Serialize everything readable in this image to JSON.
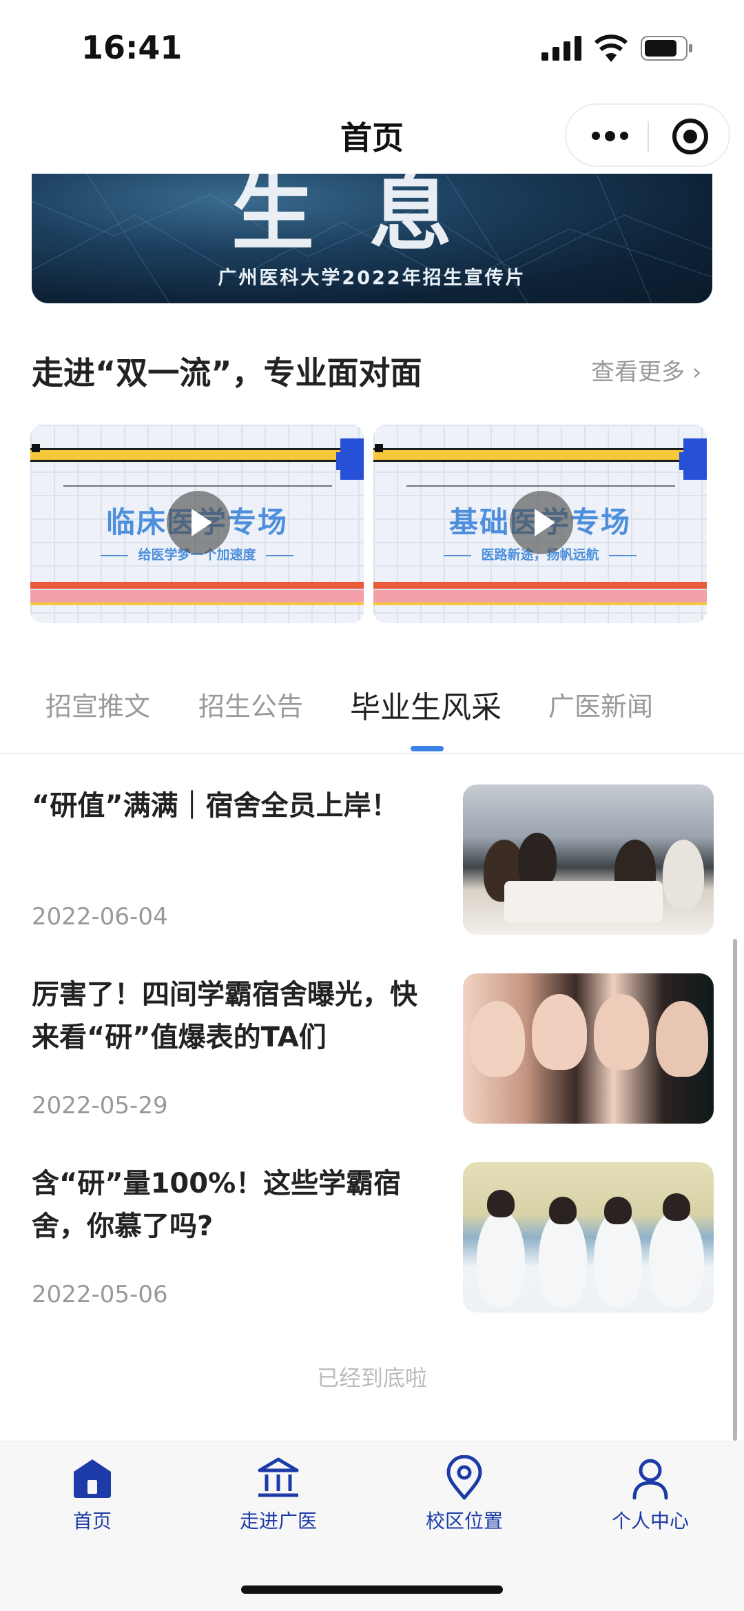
{
  "status_bar": {
    "time": "16:41"
  },
  "nav": {
    "title": "首页"
  },
  "banner": {
    "big_text": "生息",
    "subtitle": "广州医科大学2022年招生宣传片"
  },
  "section": {
    "title": "走进“双一流”，专业面对面",
    "more": "查看更多 ›"
  },
  "videos": [
    {
      "title": "临床医学专场",
      "subtitle": "给医学梦一个加速度"
    },
    {
      "title": "基础医学专场",
      "subtitle": "医路新途，扬帆远航"
    }
  ],
  "tabs": [
    {
      "label": "招宣推文",
      "active": false
    },
    {
      "label": "招生公告",
      "active": false
    },
    {
      "label": "毕业生风采",
      "active": true
    },
    {
      "label": "广医新闻",
      "active": false
    }
  ],
  "articles": [
    {
      "title": "“研值”满满｜宿舍全员上岸！",
      "date": "2022-06-04"
    },
    {
      "title": "厉害了！四间学霸宿舍曝光，快来看“研”值爆表的TA们",
      "date": "2022-05-29"
    },
    {
      "title": "含“研”量100%！这些学霸宿舍，你慕了吗?",
      "date": "2022-05-06"
    }
  ],
  "end_text": "已经到底啦",
  "tabbar": [
    {
      "label": "首页",
      "icon": "home-icon"
    },
    {
      "label": "走进广医",
      "icon": "building-icon"
    },
    {
      "label": "校区位置",
      "icon": "location-icon"
    },
    {
      "label": "个人中心",
      "icon": "person-icon"
    }
  ],
  "colors": {
    "accent": "#3a82e8",
    "tabbar": "#1c3ba8"
  }
}
